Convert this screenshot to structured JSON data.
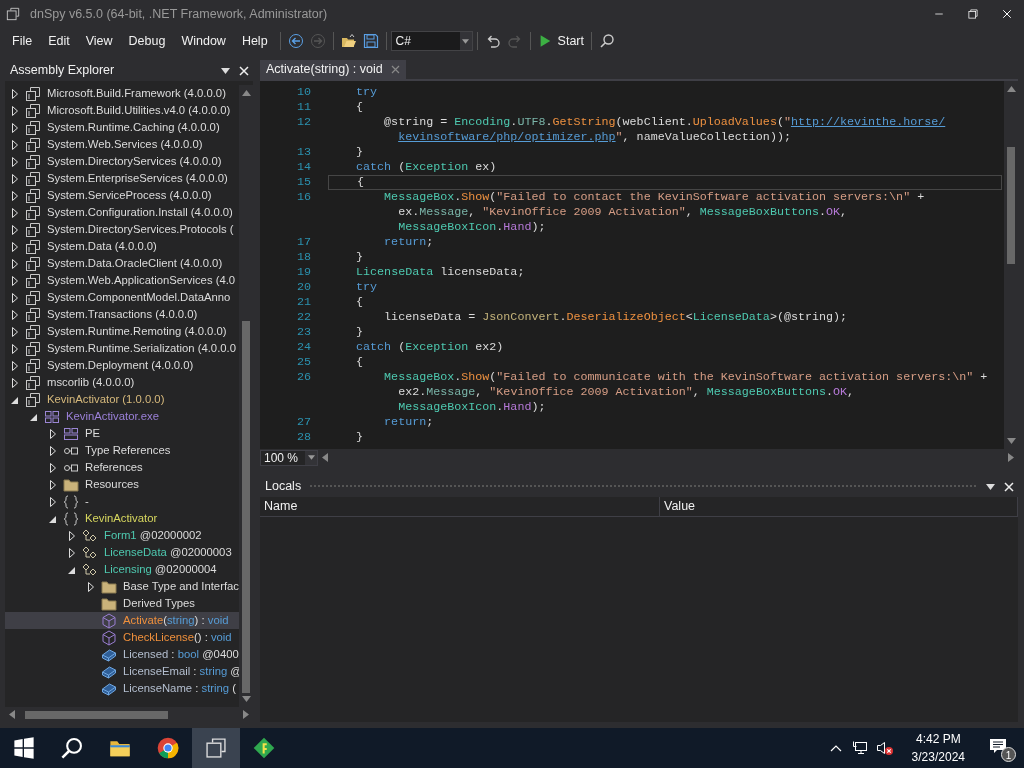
{
  "window": {
    "title": "dnSpy v6.5.0 (64-bit, .NET Framework, Administrator)"
  },
  "menu": [
    "File",
    "Edit",
    "View",
    "Debug",
    "Window",
    "Help"
  ],
  "toolbar": [
    {
      "kind": "back",
      "disabled": false
    },
    {
      "kind": "forward",
      "disabled": true
    },
    {
      "kind": "separator"
    },
    {
      "kind": "open",
      "disabled": false
    },
    {
      "kind": "save",
      "disabled": false
    },
    {
      "kind": "separator"
    },
    {
      "kind": "language",
      "value": "C#"
    },
    {
      "kind": "separator"
    },
    {
      "kind": "undo",
      "disabled": false
    },
    {
      "kind": "redo",
      "disabled": true
    },
    {
      "kind": "separator"
    },
    {
      "kind": "start",
      "label": "Start"
    },
    {
      "kind": "separator"
    },
    {
      "kind": "search",
      "disabled": false
    }
  ],
  "assembly_explorer": {
    "title": "Assembly Explorer",
    "tree": [
      {
        "kind": "assembly",
        "expanded": false,
        "label": "Microsoft.Build.Framework (4.0.0.0)"
      },
      {
        "kind": "assembly",
        "expanded": false,
        "label": "Microsoft.Build.Utilities.v4.0 (4.0.0.0)"
      },
      {
        "kind": "assembly",
        "expanded": false,
        "label": "System.Runtime.Caching (4.0.0.0)"
      },
      {
        "kind": "assembly",
        "expanded": false,
        "label": "System.Web.Services (4.0.0.0)"
      },
      {
        "kind": "assembly",
        "expanded": false,
        "label": "System.DirectoryServices (4.0.0.0)"
      },
      {
        "kind": "assembly",
        "expanded": false,
        "label": "System.EnterpriseServices (4.0.0.0)"
      },
      {
        "kind": "assembly",
        "expanded": false,
        "label": "System.ServiceProcess (4.0.0.0)"
      },
      {
        "kind": "assembly",
        "expanded": false,
        "label": "System.Configuration.Install (4.0.0.0)"
      },
      {
        "kind": "assembly",
        "expanded": false,
        "label": "System.DirectoryServices.Protocols ("
      },
      {
        "kind": "assembly",
        "expanded": false,
        "label": "System.Data (4.0.0.0)"
      },
      {
        "kind": "assembly",
        "expanded": false,
        "label": "System.Data.OracleClient (4.0.0.0)"
      },
      {
        "kind": "assembly",
        "expanded": false,
        "label": "System.Web.ApplicationServices (4.0"
      },
      {
        "kind": "assembly",
        "expanded": false,
        "label": "System.ComponentModel.DataAnno"
      },
      {
        "kind": "assembly",
        "expanded": false,
        "label": "System.Transactions (4.0.0.0)"
      },
      {
        "kind": "assembly",
        "expanded": false,
        "label": "System.Runtime.Remoting (4.0.0.0)"
      },
      {
        "kind": "assembly",
        "expanded": false,
        "label": "System.Runtime.Serialization (4.0.0.0"
      },
      {
        "kind": "assembly",
        "expanded": false,
        "label": "System.Deployment (4.0.0.0)"
      },
      {
        "kind": "assembly",
        "expanded": false,
        "label": "mscorlib (4.0.0.0)"
      },
      {
        "kind": "assembly",
        "expanded": true,
        "parts": [
          {
            "kind": "asm",
            "t": "KevinActivator (1.0.0.0)"
          }
        ],
        "children": [
          {
            "kind": "module",
            "expanded": true,
            "parts": [
              {
                "kind": "mod",
                "t": "KevinActivator.exe"
              }
            ],
            "children": [
              {
                "kind": "pe",
                "expanded": false,
                "label": "PE"
              },
              {
                "kind": "refs",
                "expanded": false,
                "label": "Type References"
              },
              {
                "kind": "refs",
                "expanded": false,
                "label": "References"
              },
              {
                "kind": "folder",
                "expanded": false,
                "label": "Resources"
              },
              {
                "kind": "namespace",
                "expanded": false,
                "label": "-"
              },
              {
                "kind": "namespace",
                "expanded": true,
                "parts": [
                  {
                    "kind": "ns",
                    "t": "KevinActivator"
                  }
                ],
                "children": [
                  {
                    "kind": "class",
                    "expanded": false,
                    "parts": [
                      {
                        "kind": "cls",
                        "t": "Form1"
                      },
                      {
                        "kind": "n",
                        "t": " @02000002"
                      }
                    ]
                  },
                  {
                    "kind": "class",
                    "expanded": false,
                    "parts": [
                      {
                        "kind": "cls",
                        "t": "LicenseData"
                      },
                      {
                        "kind": "n",
                        "t": " @02000003"
                      }
                    ]
                  },
                  {
                    "kind": "class",
                    "expanded": true,
                    "parts": [
                      {
                        "kind": "cls",
                        "t": "Licensing"
                      },
                      {
                        "kind": "n",
                        "t": " @02000004"
                      }
                    ],
                    "children": [
                      {
                        "kind": "folder",
                        "expanded": false,
                        "label": "Base Type and Interfac"
                      },
                      {
                        "kind": "folder",
                        "label": "Derived Types"
                      },
                      {
                        "kind": "method",
                        "selected": true,
                        "parts": [
                          {
                            "kind": "meth",
                            "t": "Activate"
                          },
                          {
                            "kind": "n",
                            "t": "("
                          },
                          {
                            "kind": "kw",
                            "t": "string"
                          },
                          {
                            "kind": "n",
                            "t": ") : "
                          },
                          {
                            "kind": "kw",
                            "t": "void"
                          }
                        ]
                      },
                      {
                        "kind": "method",
                        "selected": false,
                        "parts": [
                          {
                            "kind": "meth",
                            "t": "CheckLicense"
                          },
                          {
                            "kind": "n",
                            "t": "() : "
                          },
                          {
                            "kind": "kw",
                            "t": "void"
                          }
                        ]
                      },
                      {
                        "kind": "field",
                        "selected": false,
                        "parts": [
                          {
                            "kind": "fld",
                            "t": "Licensed"
                          },
                          {
                            "kind": "n",
                            "t": " : "
                          },
                          {
                            "kind": "kw",
                            "t": "bool"
                          },
                          {
                            "kind": "n",
                            "t": " @0400"
                          }
                        ]
                      },
                      {
                        "kind": "field",
                        "selected": false,
                        "parts": [
                          {
                            "kind": "fld",
                            "t": "LicenseEmail"
                          },
                          {
                            "kind": "n",
                            "t": " : "
                          },
                          {
                            "kind": "kw",
                            "t": "string"
                          },
                          {
                            "kind": "n",
                            "t": " @"
                          }
                        ]
                      },
                      {
                        "kind": "field",
                        "selected": false,
                        "parts": [
                          {
                            "kind": "fld",
                            "t": "LicenseName"
                          },
                          {
                            "kind": "n",
                            "t": " : "
                          },
                          {
                            "kind": "kw",
                            "t": "string"
                          },
                          {
                            "kind": "n",
                            "t": " ("
                          }
                        ]
                      }
                    ]
                  }
                ]
              }
            ]
          }
        ]
      }
    ]
  },
  "editor": {
    "tab": {
      "title": "Activate(string) : void"
    },
    "lines": [
      {
        "number": "10",
        "current": false,
        "tokens": [
          {
            "kind": "kw",
            "t": "    try"
          }
        ]
      },
      {
        "number": "11",
        "current": false,
        "tokens": [
          {
            "kind": "p",
            "t": "    {"
          }
        ]
      },
      {
        "number": "12",
        "current": false,
        "tokens": [
          {
            "kind": "p",
            "t": "        @string = "
          },
          {
            "kind": "ty",
            "t": "Encoding"
          },
          {
            "kind": "p",
            "t": "."
          },
          {
            "kind": "pr",
            "t": "UTF8"
          },
          {
            "kind": "p",
            "t": "."
          },
          {
            "kind": "me",
            "t": "GetString"
          },
          {
            "kind": "p",
            "t": "(webClient."
          },
          {
            "kind": "me",
            "t": "UploadValues"
          },
          {
            "kind": "p",
            "t": "("
          },
          {
            "kind": "s",
            "t": "\""
          },
          {
            "kind": "u",
            "t": "http://kevinthe.horse/"
          }
        ]
      },
      {
        "current": false,
        "tokens": [
          {
            "kind": "u",
            "t": "          kevinsoftware/php/optimizer.php"
          },
          {
            "kind": "s",
            "t": "\""
          },
          {
            "kind": "p",
            "t": ", nameValueCollection));"
          }
        ]
      },
      {
        "number": "13",
        "current": false,
        "tokens": [
          {
            "kind": "p",
            "t": "    }"
          }
        ]
      },
      {
        "number": "14",
        "current": false,
        "tokens": [
          {
            "kind": "kw",
            "t": "    catch"
          },
          {
            "kind": "p",
            "t": " ("
          },
          {
            "kind": "ty",
            "t": "Exception"
          },
          {
            "kind": "p",
            "t": " ex)"
          }
        ]
      },
      {
        "number": "15",
        "current": true,
        "tokens": [
          {
            "kind": "p",
            "t": "    {"
          }
        ]
      },
      {
        "number": "16",
        "current": false,
        "tokens": [
          {
            "kind": "ty",
            "t": "        MessageBox"
          },
          {
            "kind": "p",
            "t": "."
          },
          {
            "kind": "me",
            "t": "Show"
          },
          {
            "kind": "p",
            "t": "("
          },
          {
            "kind": "s",
            "t": "\"Failed to contact the KevinSoftware activation servers:\\n\""
          },
          {
            "kind": "p",
            "t": " +"
          }
        ]
      },
      {
        "current": false,
        "tokens": [
          {
            "kind": "p",
            "t": "          ex."
          },
          {
            "kind": "pr",
            "t": "Message"
          },
          {
            "kind": "p",
            "t": ", "
          },
          {
            "kind": "s",
            "t": "\"KevinOffice 2009 Activation\""
          },
          {
            "kind": "p",
            "t": ", "
          },
          {
            "kind": "ty",
            "t": "MessageBoxButtons"
          },
          {
            "kind": "p",
            "t": "."
          },
          {
            "kind": "en",
            "t": "OK"
          },
          {
            "kind": "p",
            "t": ","
          }
        ]
      },
      {
        "current": false,
        "tokens": [
          {
            "kind": "ty",
            "t": "          MessageBoxIcon"
          },
          {
            "kind": "p",
            "t": "."
          },
          {
            "kind": "en",
            "t": "Hand"
          },
          {
            "kind": "p",
            "t": ");"
          }
        ]
      },
      {
        "number": "17",
        "current": false,
        "tokens": [
          {
            "kind": "kw",
            "t": "        return"
          },
          {
            "kind": "p",
            "t": ";"
          }
        ]
      },
      {
        "number": "18",
        "current": false,
        "tokens": [
          {
            "kind": "p",
            "t": "    }"
          }
        ]
      },
      {
        "number": "19",
        "current": false,
        "tokens": [
          {
            "kind": "ty",
            "t": "    LicenseData"
          },
          {
            "kind": "p",
            "t": " licenseData;"
          }
        ]
      },
      {
        "number": "20",
        "current": false,
        "tokens": [
          {
            "kind": "kw",
            "t": "    try"
          }
        ]
      },
      {
        "number": "21",
        "current": false,
        "tokens": [
          {
            "kind": "p",
            "t": "    {"
          }
        ]
      },
      {
        "number": "22",
        "current": false,
        "tokens": [
          {
            "kind": "p",
            "t": "        licenseData = "
          },
          {
            "kind": "st",
            "t": "JsonConvert"
          },
          {
            "kind": "p",
            "t": "."
          },
          {
            "kind": "me",
            "t": "DeserializeObject"
          },
          {
            "kind": "p",
            "t": "<"
          },
          {
            "kind": "ty",
            "t": "LicenseData"
          },
          {
            "kind": "p",
            "t": ">(@string);"
          }
        ]
      },
      {
        "number": "23",
        "current": false,
        "tokens": [
          {
            "kind": "p",
            "t": "    }"
          }
        ]
      },
      {
        "number": "24",
        "current": false,
        "tokens": [
          {
            "kind": "kw",
            "t": "    catch"
          },
          {
            "kind": "p",
            "t": " ("
          },
          {
            "kind": "ty",
            "t": "Exception"
          },
          {
            "kind": "p",
            "t": " ex2)"
          }
        ]
      },
      {
        "number": "25",
        "current": false,
        "tokens": [
          {
            "kind": "p",
            "t": "    {"
          }
        ]
      },
      {
        "number": "26",
        "current": false,
        "tokens": [
          {
            "kind": "ty",
            "t": "        MessageBox"
          },
          {
            "kind": "p",
            "t": "."
          },
          {
            "kind": "me",
            "t": "Show"
          },
          {
            "kind": "p",
            "t": "("
          },
          {
            "kind": "s",
            "t": "\"Failed to communicate with the KevinSoftware activation servers:\\n\""
          },
          {
            "kind": "p",
            "t": " +"
          }
        ]
      },
      {
        "current": false,
        "tokens": [
          {
            "kind": "p",
            "t": "          ex2."
          },
          {
            "kind": "pr",
            "t": "Message"
          },
          {
            "kind": "p",
            "t": ", "
          },
          {
            "kind": "s",
            "t": "\"KevinOffice 2009 Activation\""
          },
          {
            "kind": "p",
            "t": ", "
          },
          {
            "kind": "ty",
            "t": "MessageBoxButtons"
          },
          {
            "kind": "p",
            "t": "."
          },
          {
            "kind": "en",
            "t": "OK"
          },
          {
            "kind": "p",
            "t": ","
          }
        ]
      },
      {
        "current": false,
        "tokens": [
          {
            "kind": "ty",
            "t": "          MessageBoxIcon"
          },
          {
            "kind": "p",
            "t": "."
          },
          {
            "kind": "en",
            "t": "Hand"
          },
          {
            "kind": "p",
            "t": ");"
          }
        ]
      },
      {
        "number": "27",
        "current": false,
        "tokens": [
          {
            "kind": "kw",
            "t": "        return"
          },
          {
            "kind": "p",
            "t": ";"
          }
        ]
      },
      {
        "number": "28",
        "current": false,
        "tokens": [
          {
            "kind": "p",
            "t": "    }"
          }
        ]
      }
    ],
    "zoom": "100 %"
  },
  "locals": {
    "title": "Locals",
    "columns": [
      "Name",
      "Value"
    ]
  },
  "taskbar": {
    "apps": [
      {
        "kind": "start",
        "active": false
      },
      {
        "kind": "search",
        "active": false
      },
      {
        "kind": "explorer",
        "active": false
      },
      {
        "kind": "browser",
        "active": false
      },
      {
        "kind": "dnspy",
        "active": true
      },
      {
        "kind": "greenapp",
        "active": false
      }
    ],
    "tray": {
      "muted": true,
      "time": "4:42 PM",
      "date": "3/23/2024",
      "notifications": "1"
    }
  }
}
